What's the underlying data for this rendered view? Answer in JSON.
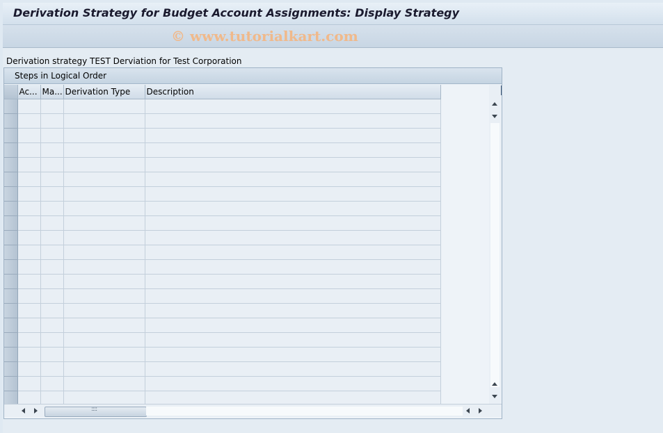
{
  "window": {
    "title": "Derivation Strategy for Budget Account Assignments: Display Strategy",
    "watermark": "© www.tutorialkart.com"
  },
  "info_line": "Derivation strategy TEST Derviation for Test Corporation",
  "steps_panel": {
    "title": "Steps in Logical Order",
    "columns": [
      "Ac...",
      "Ma...",
      "Derivation Type",
      "Description"
    ],
    "empty_row_count": 21
  },
  "colors": {
    "background": "#dfe9f2",
    "grid_cell": "#e9eff5",
    "watermark": "#f0b98b"
  },
  "icons": {
    "column_config": "table-settings-icon",
    "scroll_up": "arrow-up-icon",
    "scroll_down": "arrow-down-icon",
    "scroll_left": "arrow-left-icon",
    "scroll_right": "arrow-right-icon"
  }
}
